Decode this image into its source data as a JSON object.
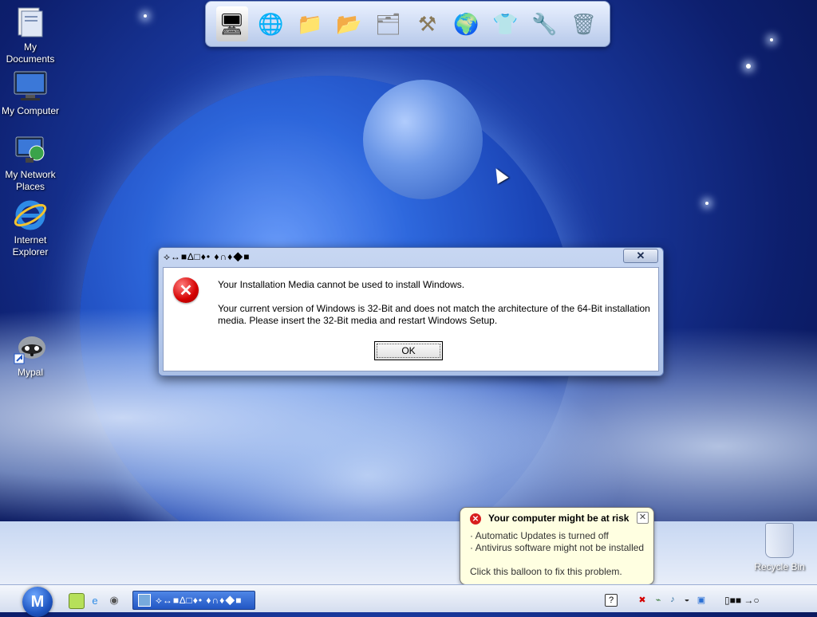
{
  "desktop": {
    "icons": [
      {
        "label": "My Documents",
        "icon": "folder-documents-icon"
      },
      {
        "label": "My Computer",
        "icon": "computer-monitor-icon"
      },
      {
        "label": "My Network Places",
        "icon": "network-places-icon"
      },
      {
        "label": "Internet Explorer",
        "icon": "internet-explorer-icon"
      },
      {
        "label": "Mypal",
        "icon": "raccoon-mypal-icon"
      }
    ],
    "recycle_bin": {
      "label": "Recycle Bin",
      "icon": "recycle-bin-icon"
    }
  },
  "dock": {
    "items": [
      {
        "icon": "control-panel-icon"
      },
      {
        "icon": "globe-network-icon"
      },
      {
        "icon": "folder-icon"
      },
      {
        "icon": "folder-green-icon"
      },
      {
        "icon": "folder-pictures-icon"
      },
      {
        "icon": "tools-icon"
      },
      {
        "icon": "globe-arrow-icon"
      },
      {
        "icon": "tshirt-icon"
      },
      {
        "icon": "hammer-wrench-icon"
      },
      {
        "icon": "recycle-bin-icon"
      }
    ]
  },
  "dialog": {
    "title": "⟡↔■∆□♦•  ♦∩♦◆■",
    "close_label": "✕",
    "heading": "Your Installation Media cannot be used to install Windows.",
    "body": "Your current version of Windows is 32-Bit and does not match the architecture of the 64-Bit installation media. Please insert the 32-Bit media and restart Windows Setup.",
    "ok_label": "OK",
    "icon": "error-x-icon"
  },
  "balloon": {
    "title": "Your computer might be at risk",
    "lines": [
      "· Automatic Updates is turned off",
      "· Antivirus software might not be installed"
    ],
    "footer": "Click this balloon to fix this problem.",
    "close_label": "✕",
    "icon": "security-shield-icon"
  },
  "taskbar": {
    "start_label": "M",
    "quick_launch": [
      {
        "icon": "show-desktop-icon"
      },
      {
        "icon": "internet-explorer-icon"
      },
      {
        "icon": "raccoon-mypal-icon"
      }
    ],
    "task_button_label": "⟡↔■∆□♦•  ♦∩♦◆■",
    "tray": [
      {
        "icon": "help-question-icon"
      },
      {
        "icon": "security-alert-icon"
      },
      {
        "icon": "network-icon"
      },
      {
        "icon": "volume-icon"
      },
      {
        "icon": "shield-icon"
      },
      {
        "icon": "display-icon"
      }
    ],
    "clock": "▯■■  →○"
  },
  "colors": {
    "dialog_frame": "#a9bfe6",
    "error_red": "#d40000",
    "balloon_bg": "#ffffe1",
    "task_button": "#2257c4"
  }
}
